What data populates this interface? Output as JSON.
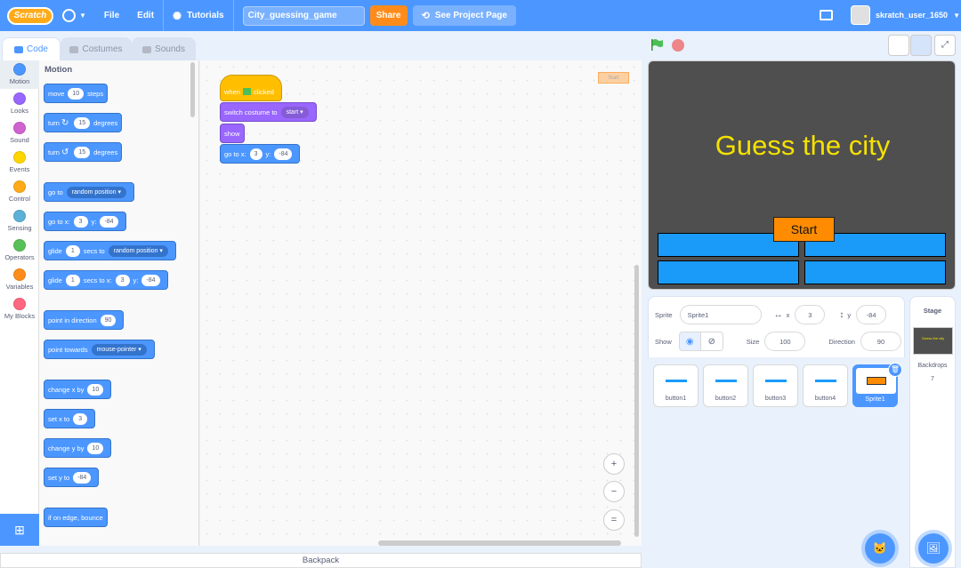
{
  "menubar": {
    "logo": "Scratch",
    "file": "File",
    "edit": "Edit",
    "tutorials": "Tutorials",
    "project_title": "City_guessing_game",
    "share": "Share",
    "see_project": "See Project Page",
    "username": "skratch_user_1650"
  },
  "tabs": {
    "code": "Code",
    "costumes": "Costumes",
    "sounds": "Sounds"
  },
  "categories": [
    {
      "label": "Motion",
      "color": "#4c97ff"
    },
    {
      "label": "Looks",
      "color": "#9966ff"
    },
    {
      "label": "Sound",
      "color": "#cf63cf"
    },
    {
      "label": "Events",
      "color": "#ffd500"
    },
    {
      "label": "Control",
      "color": "#ffab19"
    },
    {
      "label": "Sensing",
      "color": "#5cb1d6"
    },
    {
      "label": "Operators",
      "color": "#59c059"
    },
    {
      "label": "Variables",
      "color": "#ff8c1a"
    },
    {
      "label": "My Blocks",
      "color": "#ff6680"
    }
  ],
  "palette": {
    "title": "Motion",
    "move": {
      "pre": "move",
      "val": "10",
      "post": "steps"
    },
    "turn_right": {
      "pre": "turn",
      "val": "15",
      "post": "degrees"
    },
    "turn_left": {
      "pre": "turn",
      "val": "15",
      "post": "degrees"
    },
    "goto": {
      "pre": "go to",
      "drop": "random position"
    },
    "gotoxy": {
      "pre": "go to x:",
      "x": "3",
      "ylabel": "y:",
      "y": "-84"
    },
    "glide": {
      "pre": "glide",
      "val": "1",
      "mid": "secs to",
      "drop": "random position"
    },
    "glidexy": {
      "pre": "glide",
      "val": "1",
      "mid": "secs to x:",
      "x": "3",
      "ylabel": "y:",
      "y": "-84"
    },
    "point_dir": {
      "pre": "point in direction",
      "val": "90"
    },
    "point_towards": {
      "pre": "point towards",
      "drop": "mouse-pointer"
    },
    "change_x": {
      "pre": "change x by",
      "val": "10"
    },
    "set_x": {
      "pre": "set x to",
      "val": "3"
    },
    "change_y": {
      "pre": "change y by",
      "val": "10"
    },
    "set_y": {
      "pre": "set y to",
      "val": "-84"
    },
    "bounce": "if on edge, bounce"
  },
  "script": {
    "hat_pre": "when",
    "hat_post": "clicked",
    "switch_costume": {
      "pre": "switch costume to",
      "drop": "start"
    },
    "show": "show",
    "gotoxy": {
      "pre": "go to x:",
      "x": "3",
      "ylabel": "y:",
      "y": "-84"
    },
    "sprite_tag": "Start"
  },
  "zoom": {
    "in": "+",
    "out": "−",
    "reset": "="
  },
  "backpack": "Backpack",
  "stage": {
    "title": "Guess the city",
    "start": "Start"
  },
  "sprite_info": {
    "sprite_label": "Sprite",
    "sprite_name": "Sprite1",
    "x_label": "x",
    "x": "3",
    "y_label": "y",
    "y": "-84",
    "show_label": "Show",
    "size_label": "Size",
    "size": "100",
    "direction_label": "Direction",
    "direction": "90"
  },
  "sprites": [
    "button1",
    "button2",
    "button3",
    "button4",
    "Sprite1"
  ],
  "stage_col": {
    "header": "Stage",
    "thumb_title": "Guess the city",
    "backdrops_label": "Backdrops",
    "backdrops_count": "7"
  },
  "colors": {
    "accent": "#4c97ff",
    "share": "#ff8c1a",
    "stage_title": "#f5e100",
    "stage_button": "#1a9bfa"
  }
}
